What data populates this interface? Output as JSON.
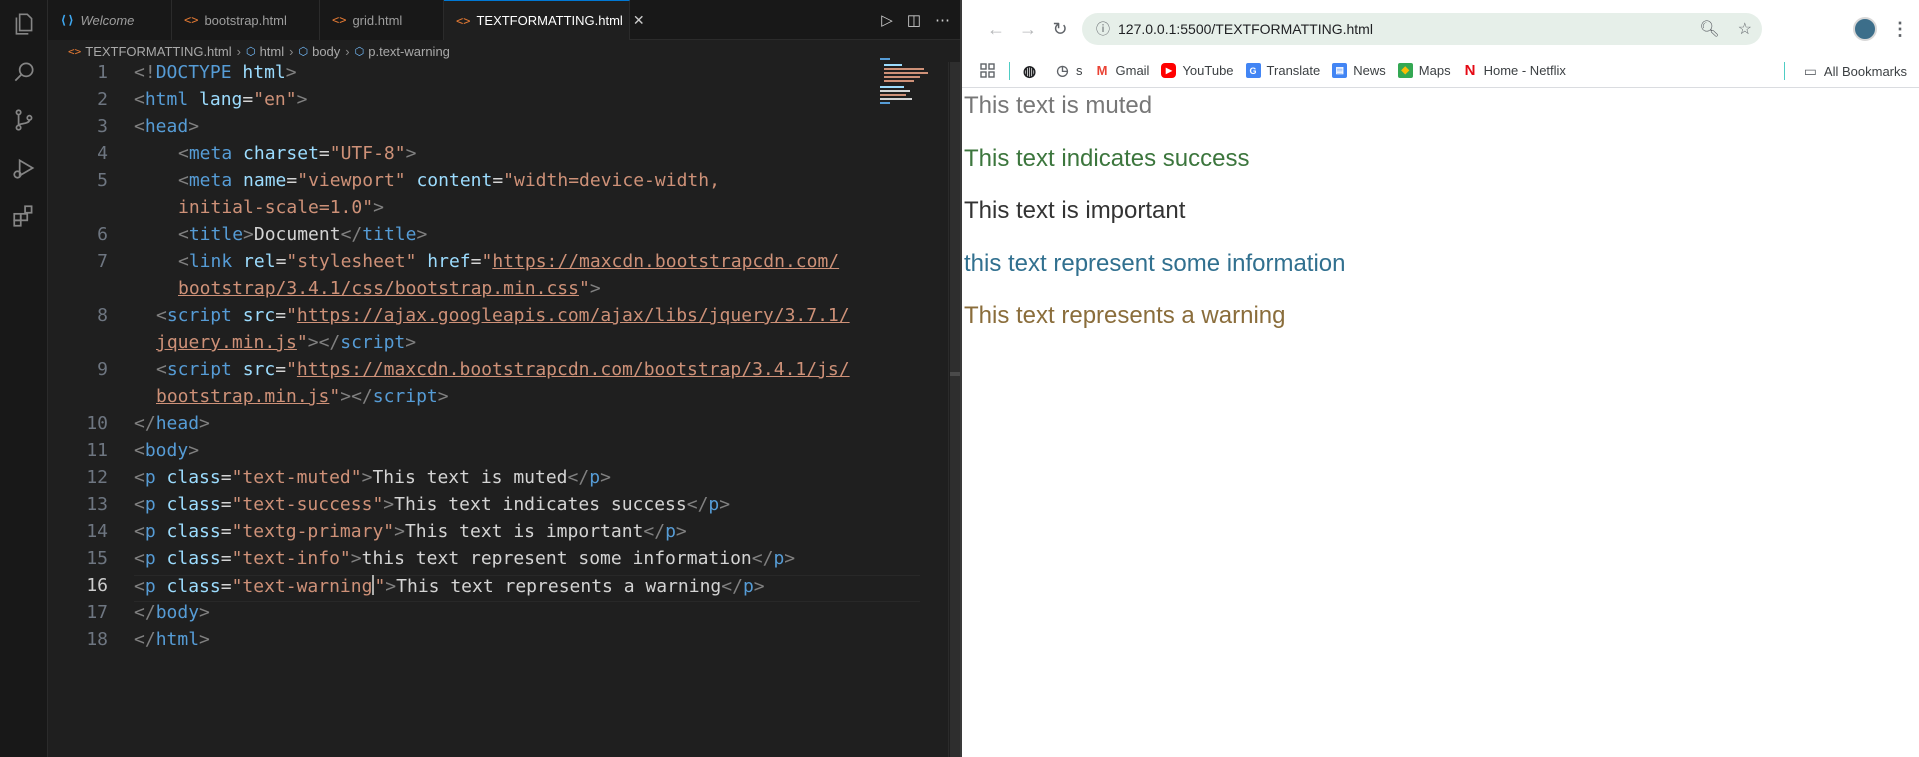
{
  "vscode": {
    "tabs": [
      {
        "label": "Welcome",
        "icon": "vscode-icon"
      },
      {
        "label": "bootstrap.html",
        "icon": "html-icon"
      },
      {
        "label": "grid.html",
        "icon": "html-icon"
      },
      {
        "label": "TEXTFORMATTING.html",
        "icon": "html-icon",
        "active": true
      }
    ],
    "breadcrumb": [
      "TEXTFORMATTING.html",
      "html",
      "body",
      "p.text-warning"
    ],
    "line_numbers": [
      "1",
      "2",
      "3",
      "4",
      "5",
      "6",
      "7",
      "8",
      "9",
      "10",
      "11",
      "12",
      "13",
      "14",
      "15",
      "16",
      "17",
      "18"
    ],
    "current_line": "16",
    "code": {
      "l1_doctype": "DOCTYPE",
      "l1_html": "html",
      "l2_tag": "html",
      "l2_attr": "lang",
      "l2_val": "\"en\"",
      "l3_tag": "head",
      "l4_tag": "meta",
      "l4_attr": "charset",
      "l4_val": "\"UTF-8\"",
      "l5_tag": "meta",
      "l5_attr1": "name",
      "l5_val1": "\"viewport\"",
      "l5_attr2": "content",
      "l5_val2a": "\"width=device-width,",
      "l5_val2b": "initial-scale=1.0\"",
      "l6_tag": "title",
      "l6_text": "Document",
      "l7_tag": "link",
      "l7_attr1": "rel",
      "l7_val1": "\"stylesheet\"",
      "l7_attr2": "href",
      "l7_url1": "https://maxcdn.bootstrapcdn.com/",
      "l7_url2": "bootstrap/3.4.1/css/bootstrap.min.css",
      "l8_tag": "script",
      "l8_attr": "src",
      "l8_url1": "https://ajax.googleapis.com/ajax/libs/jquery/3.7.1/",
      "l8_url2": "jquery.min.js",
      "l9_tag": "script",
      "l9_attr": "src",
      "l9_url1": "https://maxcdn.bootstrapcdn.com/bootstrap/3.4.1/js/",
      "l9_url2": "bootstrap.min.js",
      "l10_tag": "head",
      "l11_tag": "body",
      "p_tag": "p",
      "class_attr": "class",
      "l12_class": "\"text-muted\"",
      "l12_text": "This text is muted",
      "l13_class": "\"text-success\"",
      "l13_text": "This text indicates success",
      "l14_class": "\"textg-primary\"",
      "l14_text": "This text is important",
      "l15_class": "\"text-info\"",
      "l15_text": "this text represent some information",
      "l16_class_a": "\"text-warning",
      "l16_class_b": "\"",
      "l16_text": "This text represents a warning",
      "l17_tag": "body",
      "l18_tag": "html"
    }
  },
  "chrome": {
    "url": "127.0.0.1:5500/TEXTFORMATTING.html",
    "bookmarks": [
      {
        "label": "",
        "icon": "globe-icon"
      },
      {
        "label": "s",
        "icon": "history-icon"
      },
      {
        "label": "Gmail",
        "icon": "gmail-icon"
      },
      {
        "label": "YouTube",
        "icon": "youtube-icon"
      },
      {
        "label": "Translate",
        "icon": "translate-icon"
      },
      {
        "label": "News",
        "icon": "news-icon"
      },
      {
        "label": "Maps",
        "icon": "maps-icon"
      },
      {
        "label": "Home - Netflix",
        "icon": "netflix-icon"
      }
    ],
    "all_bookmarks": "All Bookmarks",
    "page_paragraphs": [
      {
        "text": "This text is muted",
        "color": "#777777"
      },
      {
        "text": "This text indicates success",
        "color": "#3c763d"
      },
      {
        "text": "This text is important",
        "color": "#333333"
      },
      {
        "text": "this text represent some information",
        "color": "#31708f"
      },
      {
        "text": "This text represents a warning",
        "color": "#8a6d3b"
      }
    ]
  },
  "colors": {
    "tag": "#569cd6",
    "attr": "#9cdcfe",
    "string": "#ce9178",
    "vscode_accent": "#0078d4"
  }
}
